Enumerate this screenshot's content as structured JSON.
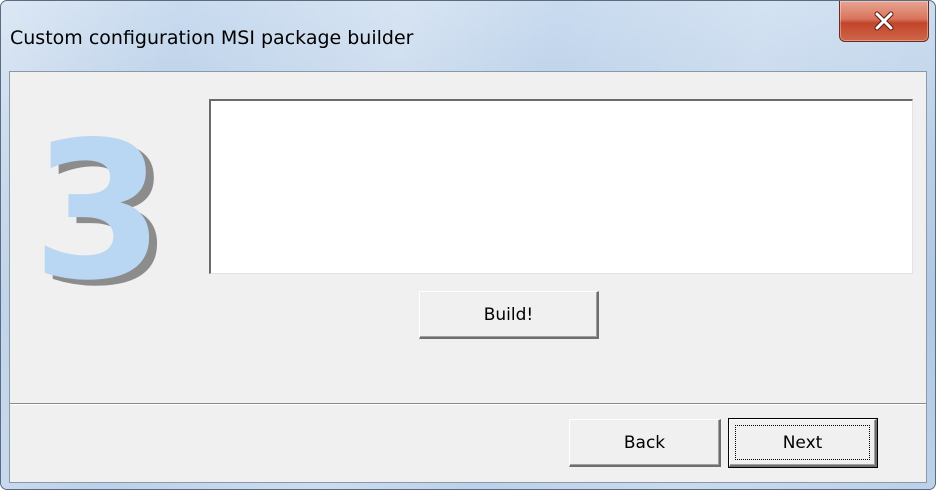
{
  "window": {
    "title": "Custom configuration MSI package builder"
  },
  "titlebar": {
    "close_icon": "close-icon"
  },
  "step": {
    "number": "3"
  },
  "log": {
    "value": ""
  },
  "buttons": {
    "build_label": "Build!",
    "back_label": "Back",
    "next_label": "Next"
  },
  "colors": {
    "step_number": "#b9d6f2",
    "step_shadow": "#8c8c8c",
    "close_button": "#c2452a",
    "dialog_background": "#f0f0f0"
  }
}
